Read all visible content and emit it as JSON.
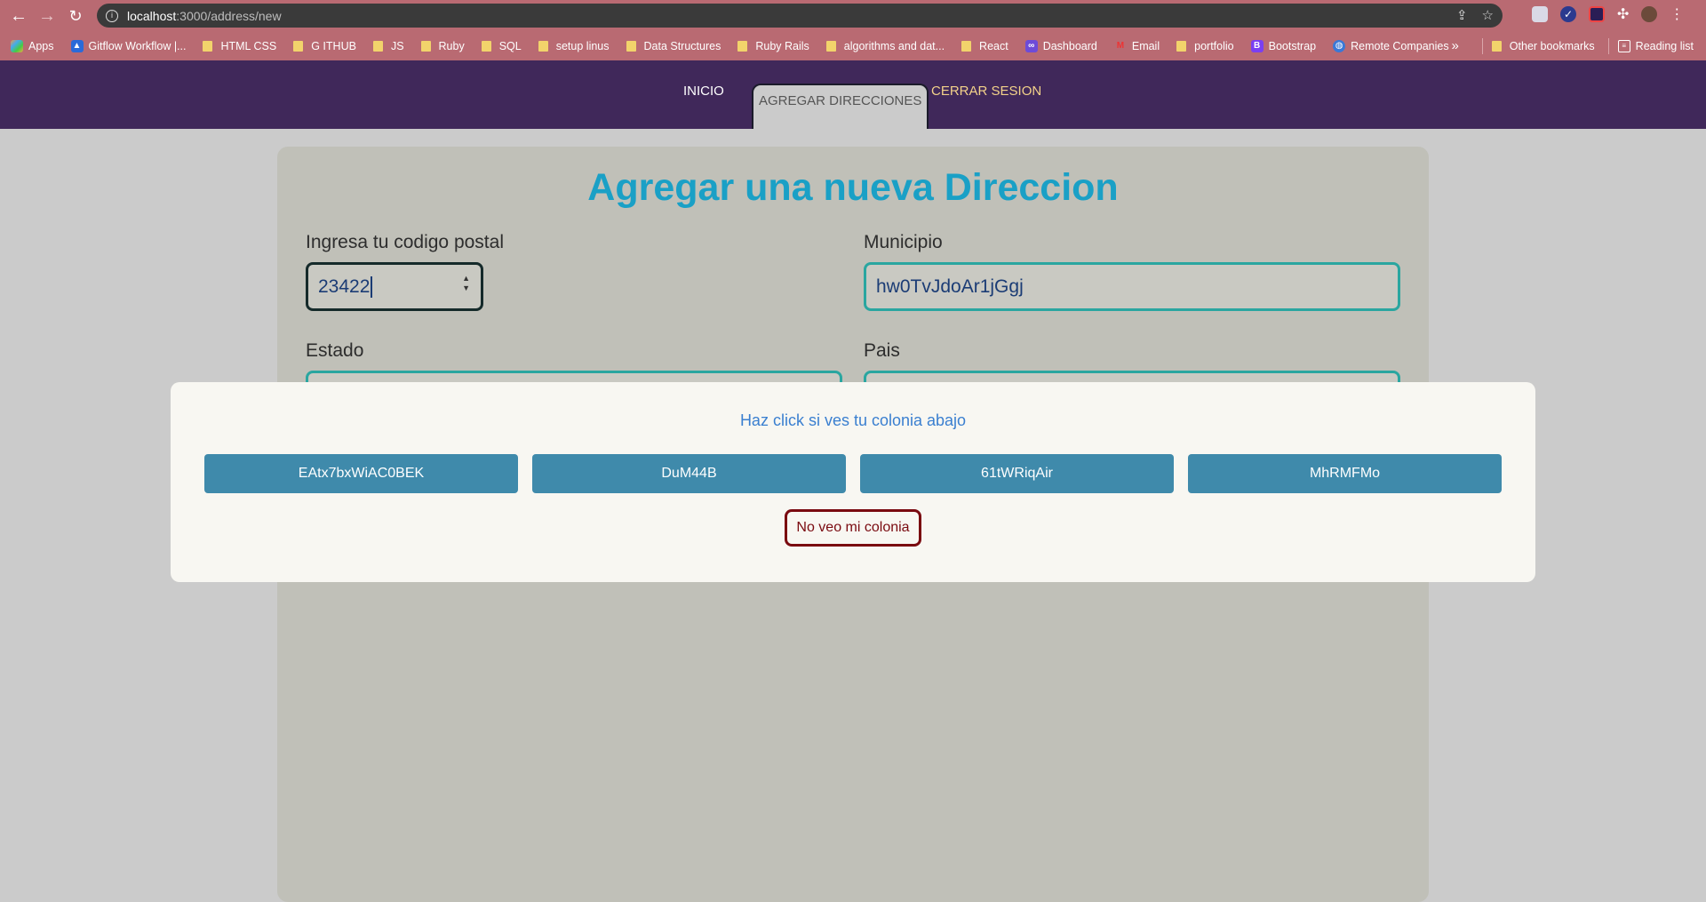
{
  "browser": {
    "url_host": "localhost",
    "url_path": ":3000/address/new",
    "bookmarks": [
      {
        "label": "Apps",
        "type": "apps"
      },
      {
        "label": "Gitflow Workflow |...",
        "type": "site"
      },
      {
        "label": "HTML CSS",
        "type": "folder"
      },
      {
        "label": "G ITHUB",
        "type": "folder"
      },
      {
        "label": "JS",
        "type": "folder"
      },
      {
        "label": "Ruby",
        "type": "folder"
      },
      {
        "label": "SQL",
        "type": "folder"
      },
      {
        "label": "setup linus",
        "type": "folder"
      },
      {
        "label": "Data Structures",
        "type": "folder"
      },
      {
        "label": "Ruby Rails",
        "type": "folder"
      },
      {
        "label": "algorithms and dat...",
        "type": "folder"
      },
      {
        "label": "React",
        "type": "folder"
      },
      {
        "label": "Dashboard",
        "type": "site"
      },
      {
        "label": "Email",
        "type": "site"
      },
      {
        "label": "portfolio",
        "type": "folder"
      },
      {
        "label": "Bootstrap",
        "type": "site"
      },
      {
        "label": "Remote Companies",
        "type": "site"
      }
    ],
    "overflow": "»",
    "other_bookmarks": "Other bookmarks",
    "reading_list": "Reading list"
  },
  "nav": {
    "inicio": "INICIO",
    "agregar": "AGREGAR DIRECCIONES",
    "cerrar": "CERRAR SESION"
  },
  "form": {
    "title": "Agregar una nueva Direccion",
    "zip_label": "Ingresa tu codigo postal",
    "zip_value": "23422",
    "municipio_label": "Municipio",
    "municipio_value": "hw0TvJdoAr1jGgj",
    "estado_label": "Estado",
    "pais_label": "Pais"
  },
  "modal": {
    "prompt": "Haz click si ves tu colonia abajo",
    "colonias": [
      "EAtx7bxWiAC0BEK",
      "DuM44B",
      "61tWRiqAir",
      "MhRMFMo"
    ],
    "no_colonia": "No veo mi colonia"
  },
  "colors": {
    "nav_bg": "#40285a",
    "title": "#1aa0c6",
    "colonia_btn": "#3f8aab",
    "danger": "#7a0a10"
  }
}
